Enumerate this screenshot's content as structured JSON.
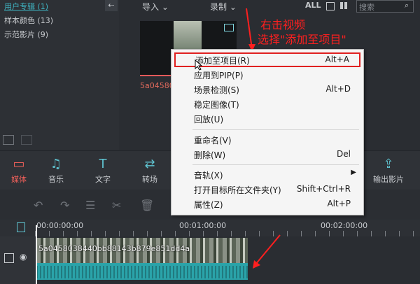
{
  "sidebar": {
    "items": [
      {
        "label": "用户专辑 (1)"
      },
      {
        "label": "样本颜色 (13)"
      },
      {
        "label": "示范影片 (9)"
      }
    ],
    "collapse": "⇠"
  },
  "topbar": {
    "import": "导入",
    "record": "录制",
    "all": "ALL",
    "search_placeholder": "搜索"
  },
  "media": {
    "clip_name": "5a04580"
  },
  "annotation": {
    "line1": "右击视频",
    "line2": "选择\"添加至项目\""
  },
  "context_menu": {
    "items": [
      {
        "label": "添加至项目(R)",
        "shortcut": "Alt+A"
      },
      {
        "label": "应用到PIP(P)",
        "shortcut": ""
      },
      {
        "label": "场景检测(S)",
        "shortcut": "Alt+D"
      },
      {
        "label": "稳定图像(T)",
        "shortcut": ""
      },
      {
        "label": "回放(U)",
        "shortcut": ""
      },
      {
        "label": "重命名(V)",
        "shortcut": ""
      },
      {
        "label": "删除(W)",
        "shortcut": "Del"
      },
      {
        "label": "音轨(X)",
        "shortcut": ""
      },
      {
        "label": "打开目标所在文件夹(Y)",
        "shortcut": "Shift+Ctrl+R"
      },
      {
        "label": "属性(Z)",
        "shortcut": "Alt+P"
      }
    ]
  },
  "toolbar": {
    "media": "媒体",
    "music": "音乐",
    "text": "文字",
    "transition": "转场",
    "export": "输出影片"
  },
  "timeline": {
    "t0": "00:00:00:00",
    "t1": "00:01:00:00",
    "t2": "00:02:00:00",
    "clip_label": "5a0458038440bb88143b879e851dd4a"
  },
  "colors": {
    "accent": "#3fb6c4",
    "active_tool": "#f0605a",
    "annotation": "#ff1f1f"
  }
}
